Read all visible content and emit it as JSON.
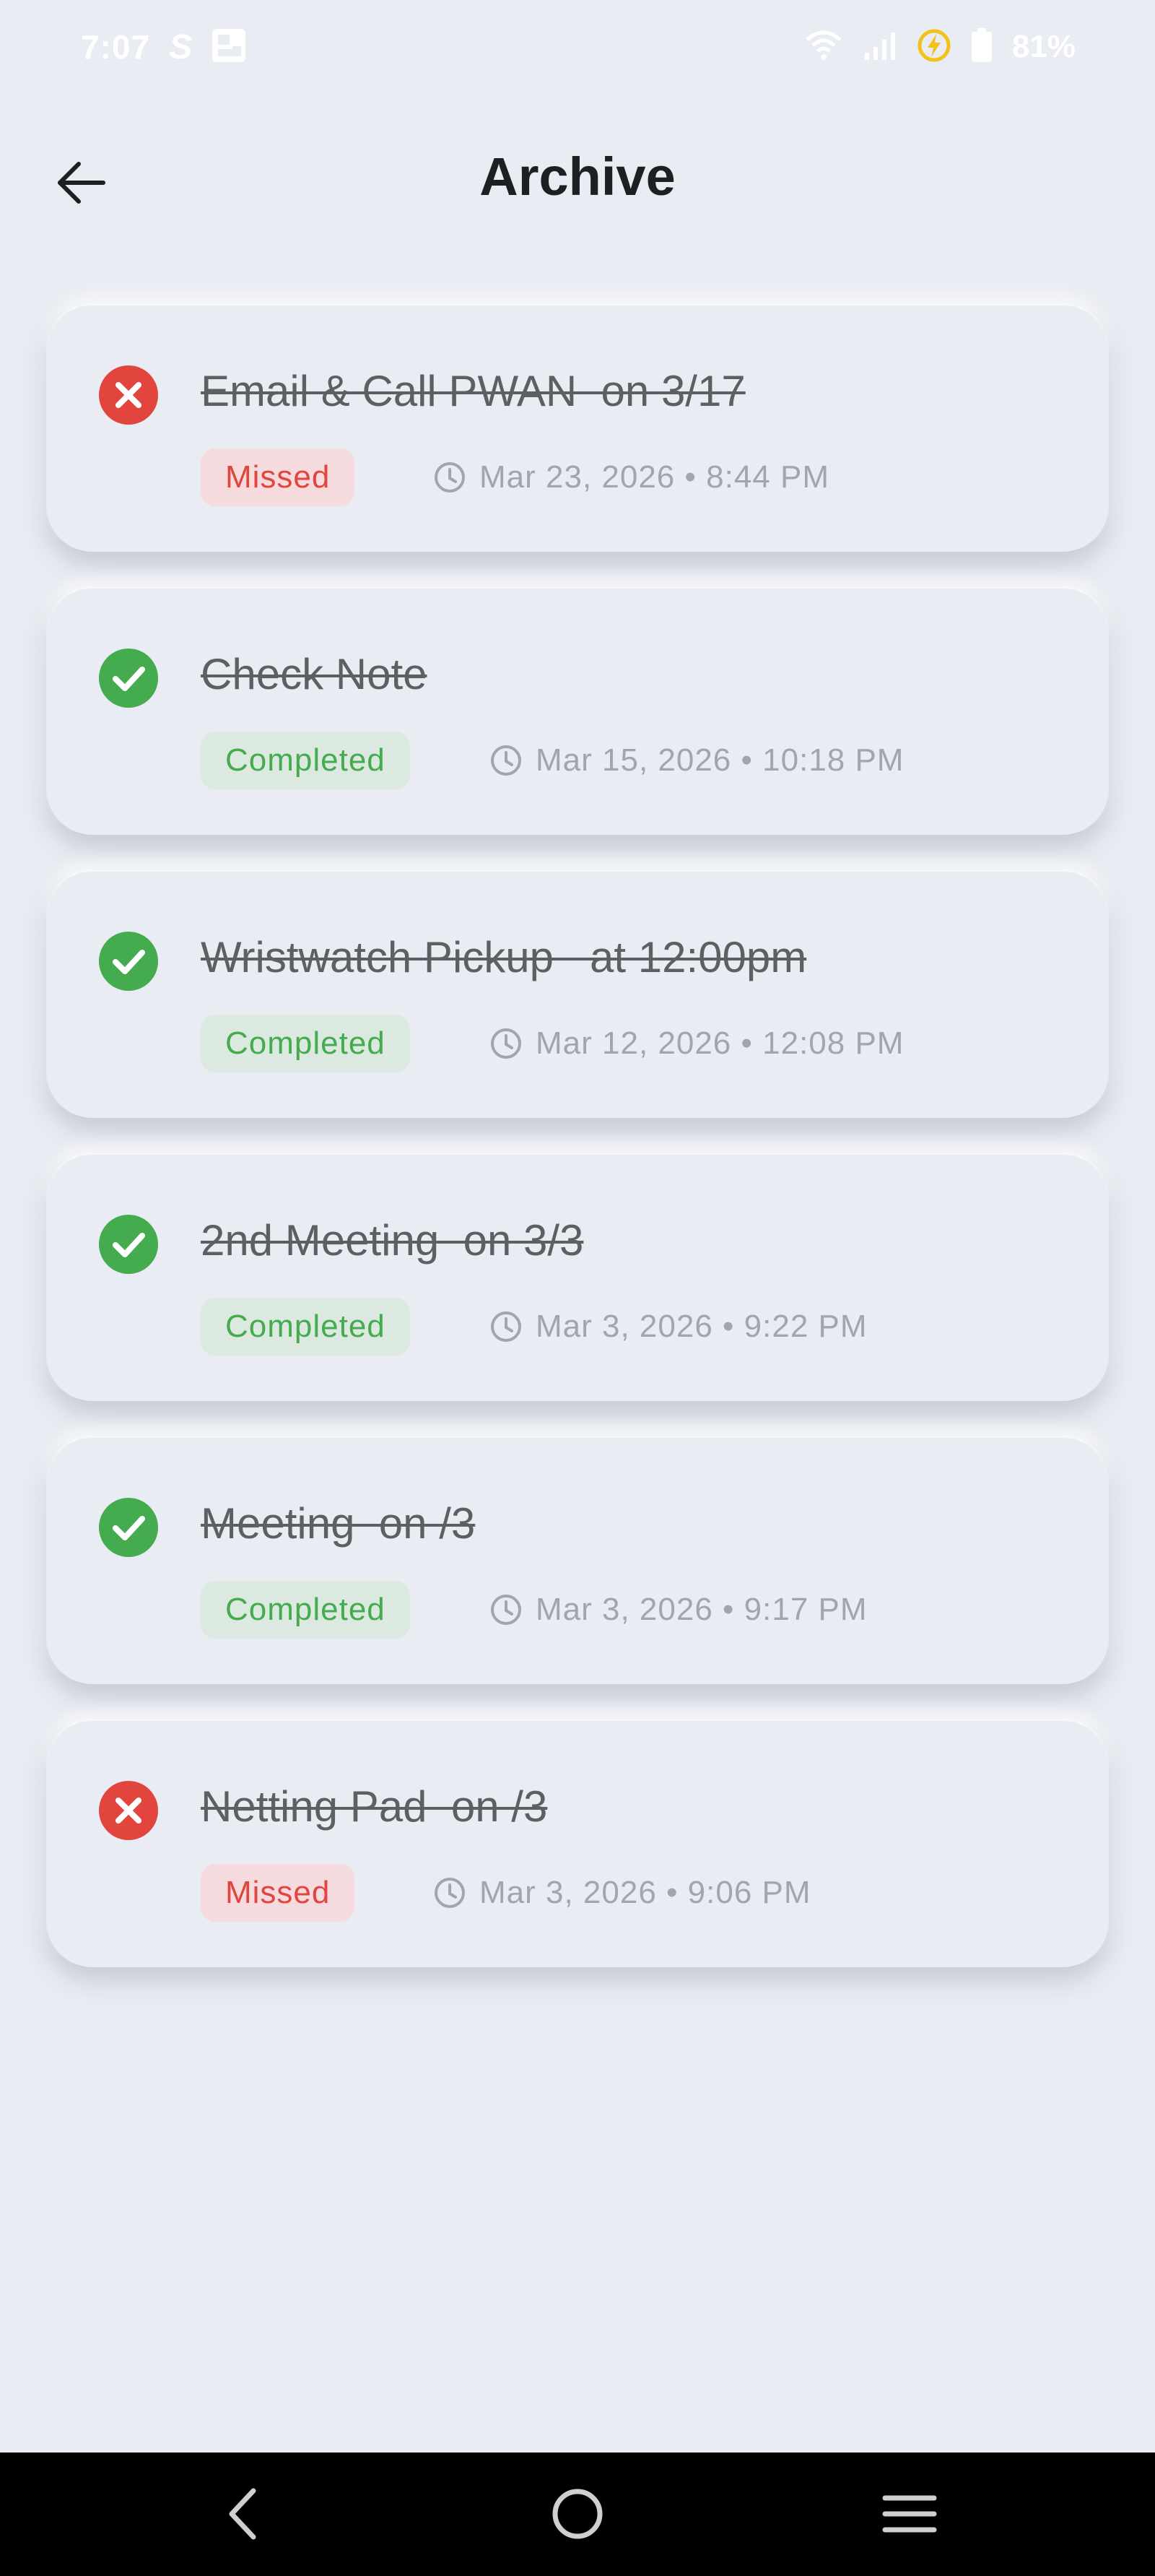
{
  "status_bar": {
    "time": "7:07",
    "carrier_icon": "S",
    "battery_percent": "81%"
  },
  "header": {
    "title": "Archive",
    "back_icon": "arrow-left-icon"
  },
  "tasks": [
    {
      "title": "Email & Call PWAN  on 3/17",
      "status": "Missed",
      "datetime": "Mar 23, 2026 • 8:44 PM",
      "icon": "x-circle-icon"
    },
    {
      "title": "Check Note",
      "status": "Completed",
      "datetime": "Mar 15, 2026 • 10:18 PM",
      "icon": "check-circle-icon"
    },
    {
      "title": "Wristwatch Pickup   at 12:00pm",
      "status": "Completed",
      "datetime": "Mar 12, 2026 • 12:08 PM",
      "icon": "check-circle-icon"
    },
    {
      "title": "2nd Meeting  on 3/3",
      "status": "Completed",
      "datetime": "Mar 3, 2026 • 9:22 PM",
      "icon": "check-circle-icon"
    },
    {
      "title": "Meeting  on /3",
      "status": "Completed",
      "datetime": "Mar 3, 2026 • 9:17 PM",
      "icon": "check-circle-icon"
    },
    {
      "title": "Netting Pad  on /3",
      "status": "Missed",
      "datetime": "Mar 3, 2026 • 9:06 PM",
      "icon": "x-circle-icon"
    }
  ],
  "colors": {
    "background": "#e9ecf2",
    "missed": "#e2453d",
    "missed_badge_bg": "#f5dbdd",
    "completed": "#45ab4f",
    "completed_badge_bg": "#dce9e1",
    "title_text": "#1e1f22",
    "task_text": "#5d5f63",
    "meta_text": "#a2a5ab"
  },
  "nav_bar": {
    "back_icon": "nav-back-icon",
    "home_icon": "nav-home-icon",
    "recents_icon": "nav-recents-icon"
  }
}
